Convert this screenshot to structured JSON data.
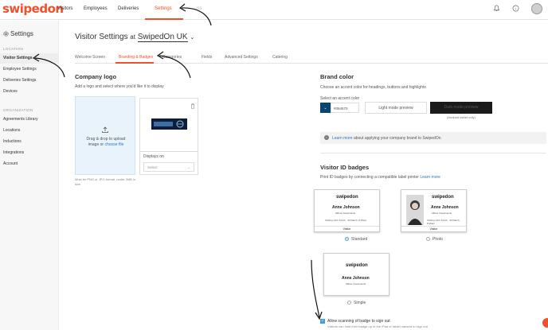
{
  "app": {
    "logo": "swipedon"
  },
  "topnav": {
    "items": [
      "Visitors",
      "Employees",
      "Deliveries",
      "Settings"
    ],
    "active": "Settings",
    "faint": "ns"
  },
  "sidebar": {
    "title": "Settings",
    "sections": [
      {
        "label": "LOCATION",
        "items": [
          "Visitor Settings",
          "Employee Settings",
          "Deliveries Settings",
          "Devices"
        ]
      },
      {
        "label": "ORGANIZATION",
        "items": [
          "Agreements Library",
          "Locations",
          "Inductions",
          "Integrations",
          "Account"
        ]
      }
    ],
    "active": "Visitor Settings"
  },
  "page": {
    "title_prefix": "Visitor Settings",
    "title_at": "at",
    "location": "SwipedOn UK"
  },
  "tabs": [
    "Welcome Screen",
    "Branding & Badges",
    "Categories",
    "Fields",
    "Advanced Settings",
    "Catering"
  ],
  "tabs_active": "Branding & Badges",
  "company_logo": {
    "heading": "Company logo",
    "desc": "Add a logo and select where you'd like it to display",
    "upload_line1": "Drag & drop to upload",
    "upload_line2": "image or",
    "upload_link": "choose file",
    "displays_on": "Displays on",
    "select_placeholder": "Select",
    "note": "Must be PNG or JPG format, under 2MB in size"
  },
  "brand_color": {
    "heading": "Brand color",
    "desc": "Choose an accent color for headings, buttons and highlights",
    "select_label": "Select an accent color",
    "hex": "#094570",
    "light_btn": "Light mode preview",
    "dark_btn": "Dark mode preview",
    "dark_note": "(Android tablet only)",
    "info_link": "Learn more",
    "info_text": "about applying your company brand to SwipedOn"
  },
  "badges": {
    "heading": "Visitor ID badges",
    "desc": "Print ID badges by connecting a compatible label printer",
    "desc_link": "Learn more",
    "card": {
      "logo": "swipedon",
      "name": "Anne Johnson",
      "company": "Allbus Investments",
      "visiting": "Visiting John Smith · 30 March, 8:15am",
      "footer": "Visitor"
    },
    "options": [
      "Standard",
      "Photo",
      "Simple"
    ],
    "selected": "Standard",
    "checkbox_label": "Allow scanning of badge to sign out",
    "checkbox_sub": "Visitors can hold their badge up to the iPad or tablet camera to sign out"
  },
  "colors": {
    "brand": "#f0512d",
    "accent": "#094570"
  }
}
